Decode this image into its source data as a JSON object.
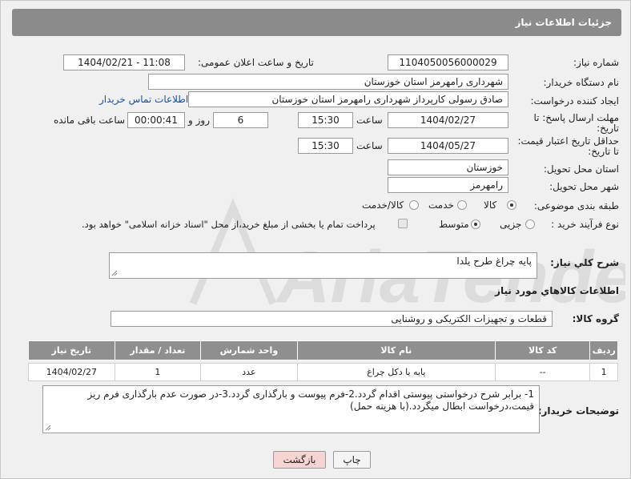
{
  "header": {
    "title": "جزئیات اطلاعات نیاز"
  },
  "need_number": {
    "label": "شماره نیاز:",
    "value": "1104050056000029"
  },
  "announce": {
    "label": "تاریخ و ساعت اعلان عمومی:",
    "value": "1404/02/21 - 11:08"
  },
  "buyer_org": {
    "label": "نام دستگاه خریدار:",
    "value": "شهرداری رامهرمز استان خوزستان"
  },
  "requester": {
    "label": "ایجاد کننده درخواست:",
    "value": "صادق رسولی کارپرداز شهرداری رامهرمز استان خوزستان",
    "contact_link": "اطلاعات تماس خریدار"
  },
  "reply_deadline": {
    "label_line1": "مهلت ارسال پاسخ: تا",
    "label_line2": "تاریخ:",
    "date": "1404/02/27",
    "time_label": "ساعت",
    "time": "15:30",
    "days": "6",
    "days_label": "روز و",
    "remaining": "00:00:41",
    "remaining_label": "ساعت باقی مانده"
  },
  "price_validity": {
    "label_line1": "حداقل تاریخ اعتبار قیمت:",
    "label_line2": "تا تاریخ:",
    "date": "1404/05/27",
    "time_label": "ساعت",
    "time": "15:30"
  },
  "delivery_province": {
    "label": "استان محل تحویل:",
    "value": "خوزستان"
  },
  "delivery_city": {
    "label": "شهر محل تحویل:",
    "value": "رامهرمز"
  },
  "category": {
    "label": "طبقه بندی موضوعی:",
    "options": [
      "کالا",
      "خدمت",
      "کالا/خدمت"
    ],
    "selected": "کالا"
  },
  "purchase_type": {
    "label": "نوع فرآیند خرید :",
    "options": [
      "جزیی",
      "متوسط"
    ],
    "selected": "متوسط",
    "note": "پرداخت تمام یا بخشی از مبلغ خرید،از محل \"اسناد خزانه اسلامی\" خواهد بود."
  },
  "description": {
    "label": "شرح کلي نياز:",
    "value": "پایه چراغ طرح یلدا"
  },
  "goods_info": {
    "title": "اطلاعات کالاهاي مورد نياز"
  },
  "goods_group": {
    "label": "گروه کالا:",
    "value": "قطعات و تجهیزات الکتریکی و روشنایی"
  },
  "table": {
    "headers": [
      "رديف",
      "کد کالا",
      "نام کالا",
      "واحد شمارش",
      "تعداد / مقدار",
      "تاریخ نیاز"
    ],
    "rows": [
      [
        "1",
        "--",
        "پایه یا دکل چراغ",
        "عدد",
        "1",
        "1404/02/27"
      ]
    ]
  },
  "buyer_notes": {
    "label": "توضیحات خریدار:",
    "value": "1- برابر شرح درخواستی پیوستی اقدام گردد.2-فرم پیوست و بارگذاری گردد.3-در صورت عدم بارگذاری فرم ریز قیمت،درخواست ابطال میگردد.(با هزینه حمل)"
  },
  "buttons": {
    "print": "چاپ",
    "back": "بازگشت"
  },
  "watermark": {
    "text": "AriaTender.neT",
    "color": "#d9d9d9"
  }
}
